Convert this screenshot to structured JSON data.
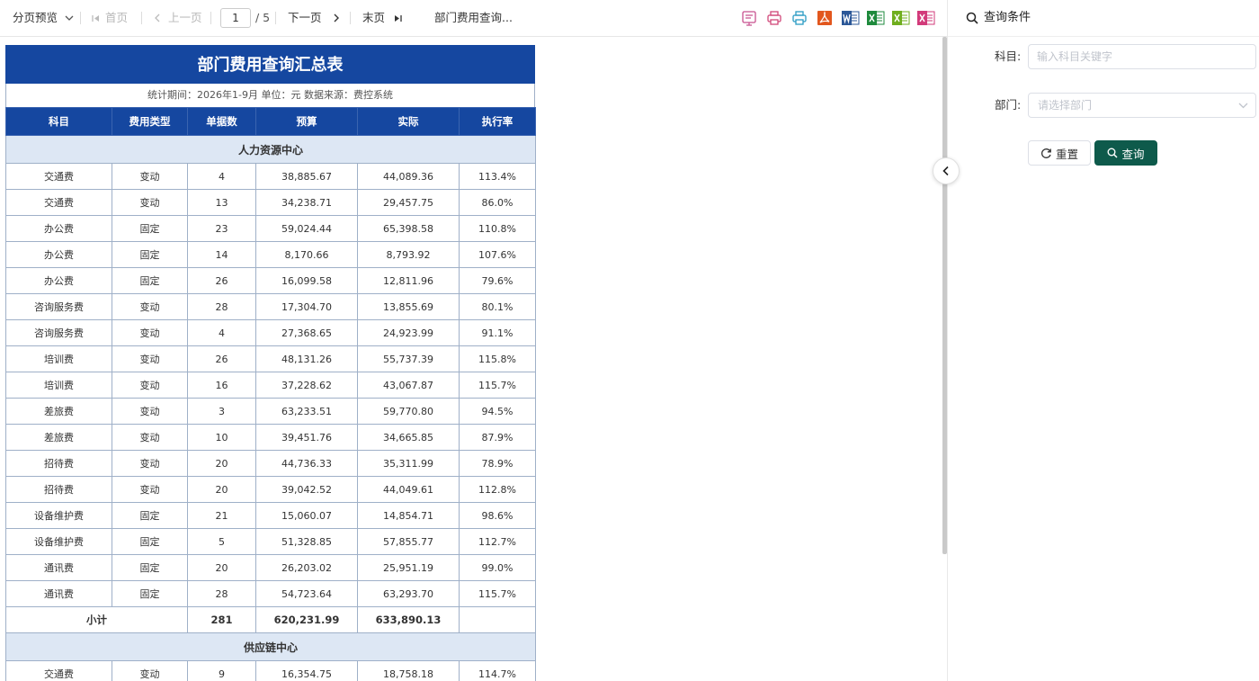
{
  "toolbar": {
    "preview_mode": "分页预览",
    "first": "首页",
    "prev": "上一页",
    "page_current": "1",
    "page_total": "/ 5",
    "next": "下一页",
    "last": "末页",
    "doc_title": "部门费用查询...",
    "icons": [
      "print-layout-icon",
      "print-icon",
      "print-preview-icon",
      "pdf-icon",
      "word-icon",
      "excel-icon",
      "excel-alt-icon",
      "excel-page-icon"
    ]
  },
  "report": {
    "title": "部门费用查询汇总表",
    "meta": "统计期间：2026年1-9月    单位：元    数据来源：费控系统",
    "columns": [
      "科目",
      "费用类型",
      "单据数",
      "预算",
      "实际",
      "执行率"
    ],
    "groups": [
      {
        "name": "人力资源中心",
        "rows": [
          [
            "交通费",
            "变动",
            "4",
            "38,885.67",
            "44,089.36",
            "113.4%"
          ],
          [
            "交通费",
            "变动",
            "13",
            "34,238.71",
            "29,457.75",
            "86.0%"
          ],
          [
            "办公费",
            "固定",
            "23",
            "59,024.44",
            "65,398.58",
            "110.8%"
          ],
          [
            "办公费",
            "固定",
            "14",
            "8,170.66",
            "8,793.92",
            "107.6%"
          ],
          [
            "办公费",
            "固定",
            "26",
            "16,099.58",
            "12,811.96",
            "79.6%"
          ],
          [
            "咨询服务费",
            "变动",
            "28",
            "17,304.70",
            "13,855.69",
            "80.1%"
          ],
          [
            "咨询服务费",
            "变动",
            "4",
            "27,368.65",
            "24,923.99",
            "91.1%"
          ],
          [
            "培训费",
            "变动",
            "26",
            "48,131.26",
            "55,737.39",
            "115.8%"
          ],
          [
            "培训费",
            "变动",
            "16",
            "37,228.62",
            "43,067.87",
            "115.7%"
          ],
          [
            "差旅费",
            "变动",
            "3",
            "63,233.51",
            "59,770.80",
            "94.5%"
          ],
          [
            "差旅费",
            "变动",
            "10",
            "39,451.76",
            "34,665.85",
            "87.9%"
          ],
          [
            "招待费",
            "变动",
            "20",
            "44,736.33",
            "35,311.99",
            "78.9%"
          ],
          [
            "招待费",
            "变动",
            "20",
            "39,042.52",
            "44,049.61",
            "112.8%"
          ],
          [
            "设备维护费",
            "固定",
            "21",
            "15,060.07",
            "14,854.71",
            "98.6%"
          ],
          [
            "设备维护费",
            "固定",
            "5",
            "51,328.85",
            "57,855.77",
            "112.7%"
          ],
          [
            "通讯费",
            "固定",
            "20",
            "26,203.02",
            "25,951.19",
            "99.0%"
          ],
          [
            "通讯费",
            "固定",
            "28",
            "54,723.64",
            "63,293.70",
            "115.7%"
          ]
        ],
        "subtotal": {
          "label": "小计",
          "count": "281",
          "budget": "620,231.99",
          "actual": "633,890.13",
          "rate": ""
        }
      },
      {
        "name": "供应链中心",
        "rows": [
          [
            "交通费",
            "变动",
            "9",
            "16,354.75",
            "18,758.18",
            "114.7%"
          ]
        ]
      }
    ]
  },
  "panel": {
    "title": "查询条件",
    "subject_label": "科目:",
    "subject_placeholder": "输入科目关键字",
    "dept_label": "部门:",
    "dept_placeholder": "请选择部门",
    "reset_label": "重置",
    "query_label": "查询"
  },
  "colors": {
    "header_blue": "#1547a0",
    "group_bg": "#dde7f4",
    "query_btn": "#0e5a4b"
  }
}
